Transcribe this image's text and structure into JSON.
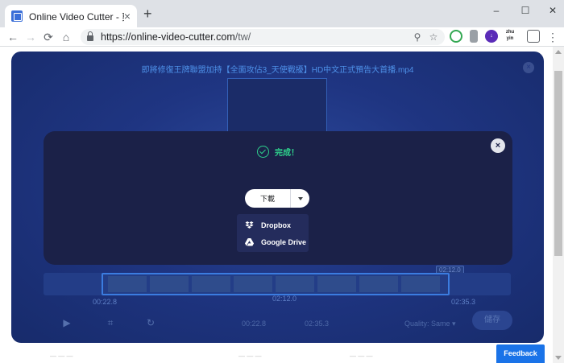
{
  "browser": {
    "tab_title": "Online Video Cutter - 剪下視訊",
    "tab_close": "×",
    "new_tab": "+",
    "url_host": "https://online-video-cutter.com",
    "url_path": "/tw/",
    "window_minimize": "–",
    "window_maximize": "☐",
    "window_close": "✕",
    "extensions": [
      "drive-ext",
      "download-ext",
      "zhuyin-ext",
      "calendar-ext"
    ],
    "ext_zhuyin_label": "zhu yin"
  },
  "editor": {
    "file_name": "即將修復王牌聯盟加持【全面攻佔3_天使戰擾】HD中文正式預告大首播.mp4",
    "close": "×",
    "time_start": "00:22.8",
    "time_mid": "02:12.0",
    "time_end": "02:35.3",
    "time_badge": "02:12.0",
    "sel_start": "00:22.8",
    "sel_end": "02:35.3",
    "quality_label": "Quality: Same ▾",
    "save_label": "儲存"
  },
  "modal": {
    "close": "×",
    "status": "完成！",
    "download_label": "下載",
    "dropdown": [
      {
        "label": "Dropbox",
        "icon": "dropbox-icon"
      },
      {
        "label": "Google Drive",
        "icon": "google-drive-icon"
      }
    ]
  },
  "page": {
    "feedback_label": "Feedback"
  },
  "colors": {
    "accent_green": "#2ed18c",
    "modal_bg": "#1b2148",
    "editor_bg": "#1f3582",
    "feedback_blue": "#1a73e8"
  }
}
